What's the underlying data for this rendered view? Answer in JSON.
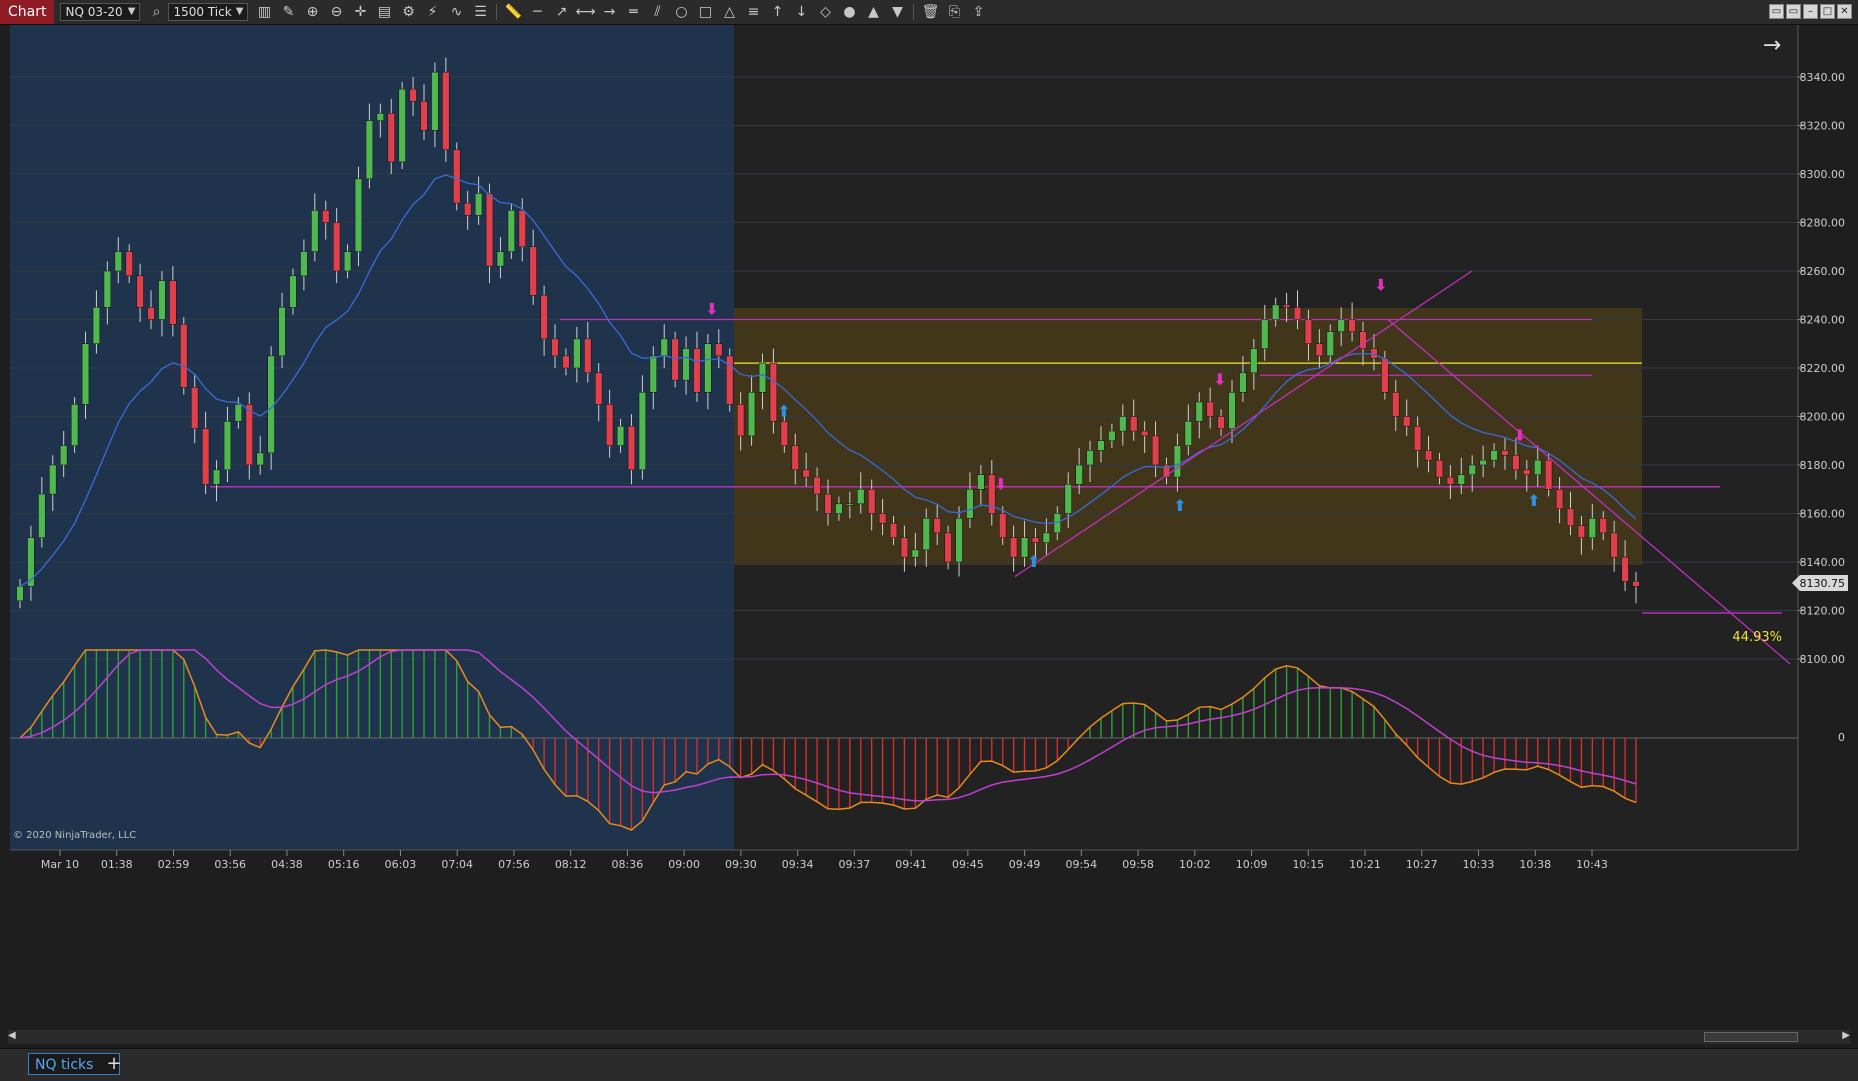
{
  "toolbar": {
    "chart_tab": "Chart",
    "instrument": "NQ 03-20",
    "interval": "1500 Tick",
    "icons": [
      "bar-type-icon",
      "pencil-icon",
      "zoom-in-icon",
      "zoom-out-icon",
      "crosshair-icon",
      "data-box-icon",
      "properties-icon",
      "strategies-icon",
      "indicators-icon",
      "templates-icon",
      "ruler-icon",
      "line-icon",
      "ray-icon",
      "extended-line-icon",
      "arrow-line-icon",
      "horizontal-line-icon",
      "parallel-lines-icon",
      "ellipse-icon",
      "rectangle-icon",
      "triangle-icon",
      "fibonacci-icon",
      "arrow-up-icon",
      "arrow-down-icon",
      "diamond-icon",
      "dot-icon",
      "triangle-up-icon",
      "triangle-down-icon",
      "trash-icon",
      "copy-icon",
      "share-icon"
    ]
  },
  "chart": {
    "price_labels": [
      "8340.00",
      "8320.00",
      "8300.00",
      "8280.00",
      "8260.00",
      "8240.00",
      "8220.00",
      "8200.00",
      "8180.00",
      "8160.00",
      "8140.00",
      "8120.00",
      "8100.00"
    ],
    "current_price": "8130.75",
    "zero_label": "0",
    "percent_label": "44.93%",
    "copyright": "© 2020 NinjaTrader, LLC",
    "time_labels": [
      "Mar 10",
      "01:38",
      "02:59",
      "03:56",
      "04:38",
      "05:16",
      "06:03",
      "07:04",
      "07:56",
      "08:12",
      "08:36",
      "09:00",
      "09:30",
      "09:34",
      "09:37",
      "09:41",
      "09:45",
      "09:49",
      "09:54",
      "09:58",
      "10:02",
      "10:09",
      "10:15",
      "10:21",
      "10:27",
      "10:33",
      "10:38",
      "10:43"
    ],
    "colors": {
      "up": "#4fb84f",
      "down": "#e0404c",
      "premarket": "#1f344c",
      "session": "#4c3c18",
      "ma": "#3b6bd8",
      "trend": "#c030c0",
      "signal_up": "#2f8fe0",
      "signal_down": "#e030c0"
    }
  },
  "chart_data": {
    "type": "candlestick",
    "instrument": "NQ 03-20",
    "interval": "1500 Tick",
    "y_range": [
      8094,
      8348
    ],
    "close_path": [
      8130,
      8150,
      8168,
      8180,
      8188,
      8205,
      8230,
      8245,
      8260,
      8268,
      8258,
      8245,
      8240,
      8256,
      8238,
      8212,
      8195,
      8172,
      8178,
      8198,
      8205,
      8180,
      8185,
      8225,
      8245,
      8258,
      8268,
      8285,
      8280,
      8260,
      8268,
      8298,
      8322,
      8325,
      8305,
      8335,
      8330,
      8318,
      8342,
      8310,
      8288,
      8283,
      8292,
      8262,
      8268,
      8285,
      8270,
      8250,
      8232,
      8225,
      8220,
      8232,
      8218,
      8205,
      8188,
      8196,
      8178,
      8210,
      8225,
      8232,
      8215,
      8228,
      8210,
      8230,
      8225,
      8205,
      8192,
      8210,
      8222,
      8198,
      8188,
      8178,
      8175,
      8168,
      8160,
      8164,
      8164,
      8170,
      8160,
      8156,
      8150,
      8142,
      8145,
      8158,
      8152,
      8140,
      8158,
      8170,
      8176,
      8160,
      8150,
      8142,
      8150,
      8148,
      8152,
      8160,
      8172,
      8180,
      8186,
      8190,
      8194,
      8200,
      8194,
      8192,
      8180,
      8175,
      8188,
      8198,
      8206,
      8200,
      8195,
      8210,
      8218,
      8228,
      8240,
      8246,
      8245,
      8240,
      8230,
      8225,
      8235,
      8240,
      8235,
      8228,
      8224,
      8210,
      8200,
      8196,
      8186,
      8182,
      8175,
      8172,
      8176,
      8180,
      8182,
      8186,
      8184,
      8178,
      8176,
      8182,
      8170,
      8162,
      8155,
      8150,
      8158,
      8152,
      8142,
      8132,
      8130
    ],
    "levels": [
      8240,
      8222,
      8217,
      8171,
      8119
    ],
    "last_price": 8130.75
  }
}
